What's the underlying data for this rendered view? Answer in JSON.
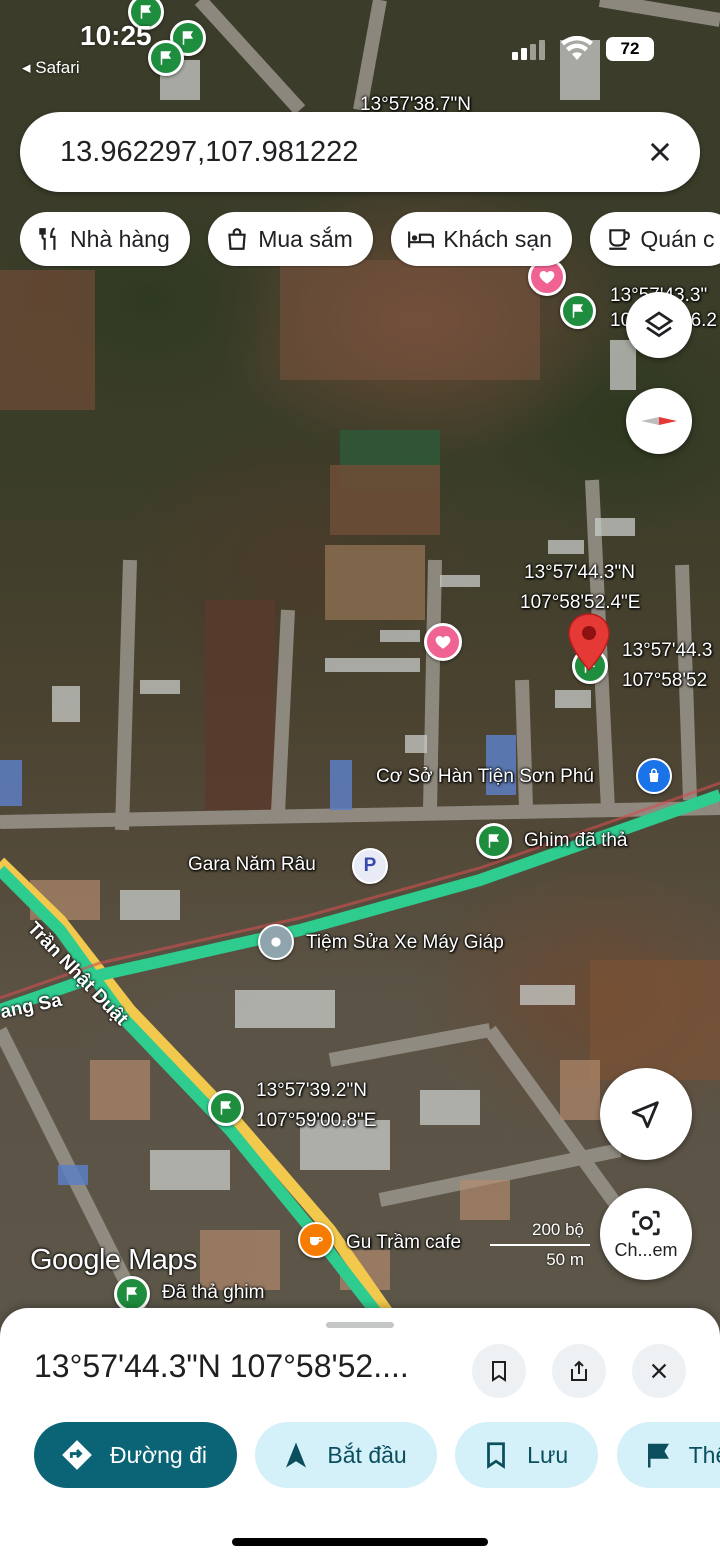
{
  "status_bar": {
    "time": "10:25",
    "back_app": "◂ Safari",
    "battery": "72"
  },
  "search": {
    "query": "13.962297,107.981222"
  },
  "chips": [
    {
      "icon": "fork-knife-icon",
      "label": "Nhà hàng"
    },
    {
      "icon": "shopping-bag-icon",
      "label": "Mua sắm"
    },
    {
      "icon": "bed-icon",
      "label": "Khách sạn"
    },
    {
      "icon": "coffee-icon",
      "label": "Quán c"
    }
  ],
  "map": {
    "pins": {
      "top": "13°57'38.7\"N",
      "right_top_1": "13°57'43.3\"",
      "right_top_2": "10",
      "right_top_3": "46.2",
      "selected_1": "13°57'44.3\"N",
      "selected_2": "107°58'52.4\"E",
      "selected_side_1": "13°57'44.3",
      "selected_side_2": "107°58'52",
      "lower_1": "13°57'39.2\"N",
      "lower_2": "107°59'00.8\"E"
    },
    "places": {
      "shop": "Cơ Sở Hàn Tiện Sơn Phú",
      "dropped_pin": "Ghim đã thả",
      "garage": "Gara Năm Râu",
      "repair": "Tiệm Sửa Xe Máy Giáp",
      "cafe": "Gu Trầm cafe",
      "dropped_pin_2": "Đã thả ghim",
      "parking": "P"
    },
    "roads": {
      "tran_nhat_duat": "Trần Nhật Duật",
      "road_left": "ang Sa"
    },
    "logo": "Google Maps",
    "scale": {
      "top": "200 bộ",
      "bottom": "50 m"
    },
    "camera_label": "Ch...em"
  },
  "sheet": {
    "title": "13°57'44.3\"N 107°58'52....",
    "actions": [
      {
        "icon": "directions-icon",
        "label": "Đường đi",
        "style": "primary"
      },
      {
        "icon": "navigation-arrow-icon",
        "label": "Bắt đầu",
        "style": "secondary"
      },
      {
        "icon": "bookmark-icon",
        "label": "Lưu",
        "style": "secondary"
      },
      {
        "icon": "flag-icon",
        "label": "Thêm",
        "style": "secondary"
      }
    ]
  },
  "colors": {
    "accent": "#0b6476",
    "pin_green": "#1e8e3e",
    "heart_pink": "#f06292",
    "route_green": "#2ecc8f",
    "road_yellow": "#f2c94c",
    "map_red_pin": "#e53935"
  }
}
